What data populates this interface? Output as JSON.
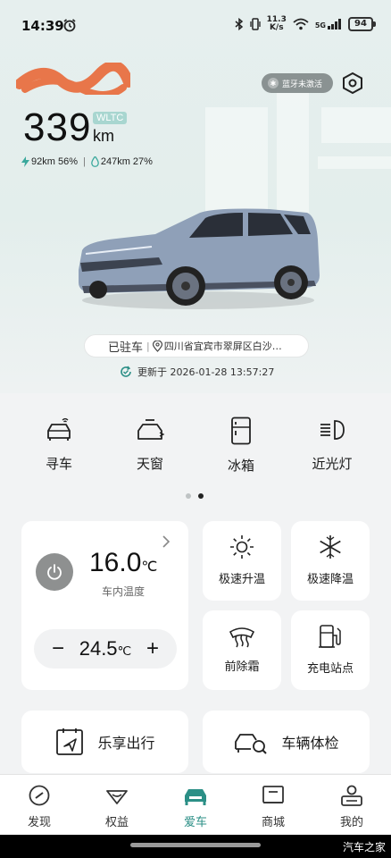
{
  "status_bar": {
    "time": "14:39",
    "net_speed_value": "11.3",
    "net_speed_unit": "K/s",
    "network": "5G",
    "battery": "94"
  },
  "header": {
    "bluetooth_badge": "蓝牙未激活"
  },
  "vehicle": {
    "range_value": "339",
    "range_standard": "WLTC",
    "range_unit": "km",
    "electric_range": "92km 56%",
    "fuel_range": "247km 27%",
    "parked_status": "已驻车",
    "location": "四川省宜宾市翠屏区白沙…",
    "updated_at": "更新于 2026-01-28 13:57:27"
  },
  "quick_actions": [
    {
      "label": "寻车",
      "icon": "car-locate-icon"
    },
    {
      "label": "天窗",
      "icon": "sunroof-icon"
    },
    {
      "label": "冰箱",
      "icon": "fridge-icon"
    },
    {
      "label": "近光灯",
      "icon": "low-beam-icon"
    }
  ],
  "pagination": {
    "current": 2,
    "total": 2
  },
  "climate": {
    "cabin_temp": "16.0",
    "cabin_temp_unit": "℃",
    "cabin_label": "车内温度",
    "set_temp": "24.5",
    "set_temp_unit": "℃",
    "minus_label": "−",
    "plus_label": "+"
  },
  "tiles": [
    {
      "label": "极速升温",
      "icon": "sun-icon"
    },
    {
      "label": "极速降温",
      "icon": "snowflake-icon"
    },
    {
      "label": "前除霜",
      "icon": "defrost-icon"
    },
    {
      "label": "充电站点",
      "icon": "charging-station-icon"
    }
  ],
  "wide_cards": [
    {
      "label": "乐享出行",
      "icon": "navigation-icon"
    },
    {
      "label": "车辆体检",
      "icon": "car-inspect-icon"
    }
  ],
  "bottom_nav": [
    {
      "label": "发现",
      "icon": "compass-icon",
      "active": false
    },
    {
      "label": "权益",
      "icon": "gift-icon",
      "active": false
    },
    {
      "label": "爱车",
      "icon": "car-icon",
      "active": true
    },
    {
      "label": "商城",
      "icon": "shop-icon",
      "active": false
    },
    {
      "label": "我的",
      "icon": "profile-icon",
      "active": false
    }
  ],
  "watermark": "汽车之家",
  "colors": {
    "accent": "#2b8f86",
    "badge_grey": "#8a9292",
    "wltc_badge": "#a8d6d0",
    "redaction": "#e8764a",
    "car_body": "#8fa0b8"
  }
}
